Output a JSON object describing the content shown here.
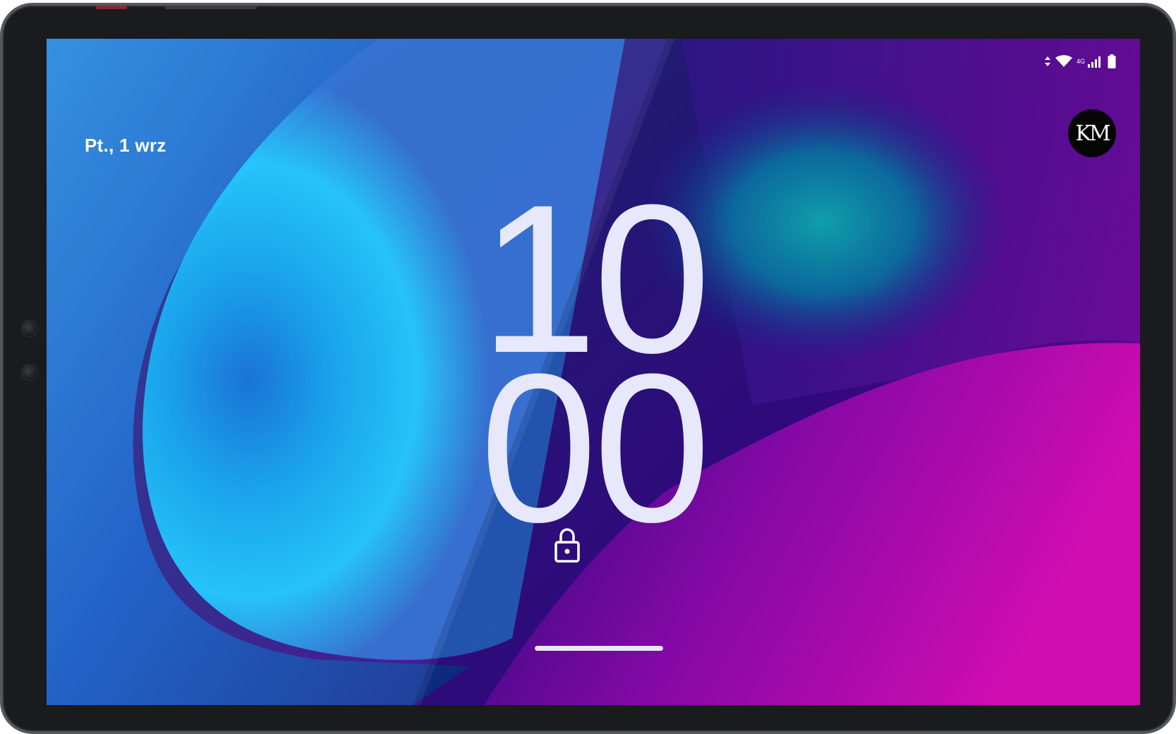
{
  "device": {
    "frame_color": "#1a1b1e",
    "accent_button_color": "#8a2a30"
  },
  "lock_screen": {
    "date": "Pt., 1 wrz",
    "clock_hours": "10",
    "clock_minutes": "00",
    "avatar_initials": "KM",
    "lock_icon": "lock-icon"
  },
  "status_bar": {
    "icons": [
      "data-transfer-icon",
      "wifi-icon",
      "cellular-signal-icon",
      "battery-icon"
    ],
    "network_label": "4G"
  },
  "colors": {
    "clock_text": "#e7e8fb",
    "wallpaper_cyan": "#00c8ff",
    "wallpaper_magenta": "#ff10d0",
    "wallpaper_violet": "#3a0a8a"
  }
}
